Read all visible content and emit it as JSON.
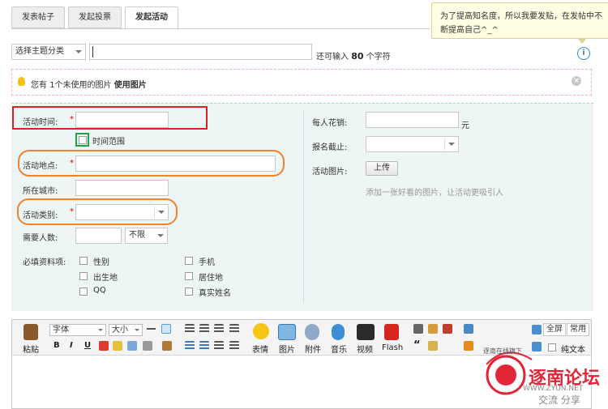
{
  "tabs": [
    {
      "label": "发表帖子",
      "active": false
    },
    {
      "label": "发起投票",
      "active": false
    },
    {
      "label": "发起活动",
      "active": true
    }
  ],
  "tooltip": {
    "text": "为了提高知名度，所以我要发贴，在发帖中不断提高自己^_^"
  },
  "subject": {
    "theme_select": "选择主题分类",
    "remaining_prefix": "还可输入",
    "remaining_count": "80",
    "remaining_suffix": "个字符"
  },
  "notice": {
    "prefix": "您有",
    "count_text": "1个未使用的图片",
    "use_link": "使用图片"
  },
  "activity": {
    "time_label": "活动时间:",
    "time_range_label": "时间范围",
    "place_label": "活动地点:",
    "city_label": "所在城市:",
    "category_label": "活动类别:",
    "people_label": "需要人数:",
    "people_limit": "不限",
    "required_label": "必填资料项:",
    "required_items": [
      "性别",
      "手机",
      "出生地",
      "居住地",
      "QQ",
      "真实姓名"
    ],
    "cost_label": "每人花销:",
    "cost_unit": "元",
    "deadline_label": "报名截止:",
    "image_label": "活动图片:",
    "upload_button": "上传",
    "image_hint": "添加一张好看的图片，让活动更吸引人",
    "required_mark": "*"
  },
  "editor": {
    "paste": "粘贴",
    "font_select": "字体",
    "size_select": "大小",
    "format_buttons": [
      "B",
      "I",
      "U"
    ],
    "big_buttons": [
      "表情",
      "图片",
      "附件",
      "音乐",
      "视频",
      "Flash"
    ],
    "quote_mark": "“",
    "fullscreen": "全屏",
    "common": "常用",
    "plain_text": "纯文本"
  },
  "watermark": {
    "top_text": "逐南在线旗下",
    "brand": "逐南论坛",
    "url": "WWW.ZYUN.NET",
    "slogan": "交流 分享"
  },
  "colors": {
    "red_highlight": "#e02020",
    "green_highlight": "#1fa346",
    "orange_highlight": "#f0822a",
    "panel_bg": "#edf5f5"
  }
}
